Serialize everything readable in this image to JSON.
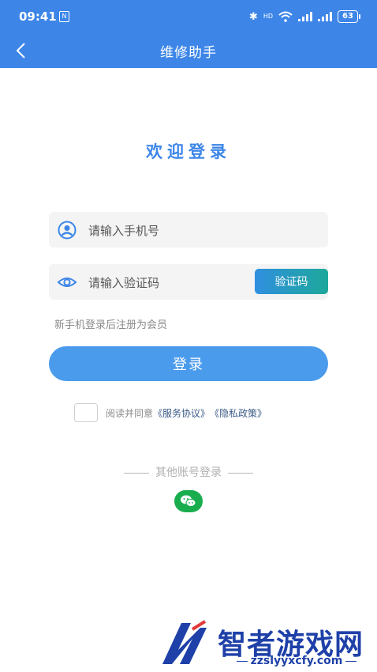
{
  "status_bar": {
    "time": "09:41",
    "nfc_label": "N",
    "network_label": "HD",
    "battery": "63"
  },
  "navbar": {
    "title": "维修助手"
  },
  "login": {
    "welcome": "欢迎登录",
    "phone_placeholder": "请输入手机号",
    "code_placeholder": "请输入验证码",
    "get_code_label": "验证码",
    "hint": "新手机登录后注册为会员",
    "login_label": "登录",
    "agree_text": "阅读并同意",
    "service_link": "《服务协议》",
    "privacy_link": "《隐私政策》",
    "other_login": "其他账号登录"
  },
  "watermark": {
    "name": "智者游戏网",
    "url": "zzslyyxcfy.com"
  },
  "colors": {
    "primary": "#3d86e8",
    "button": "#4b9bec",
    "wechat": "#1aad4e",
    "watermark": "#1e40a8"
  }
}
